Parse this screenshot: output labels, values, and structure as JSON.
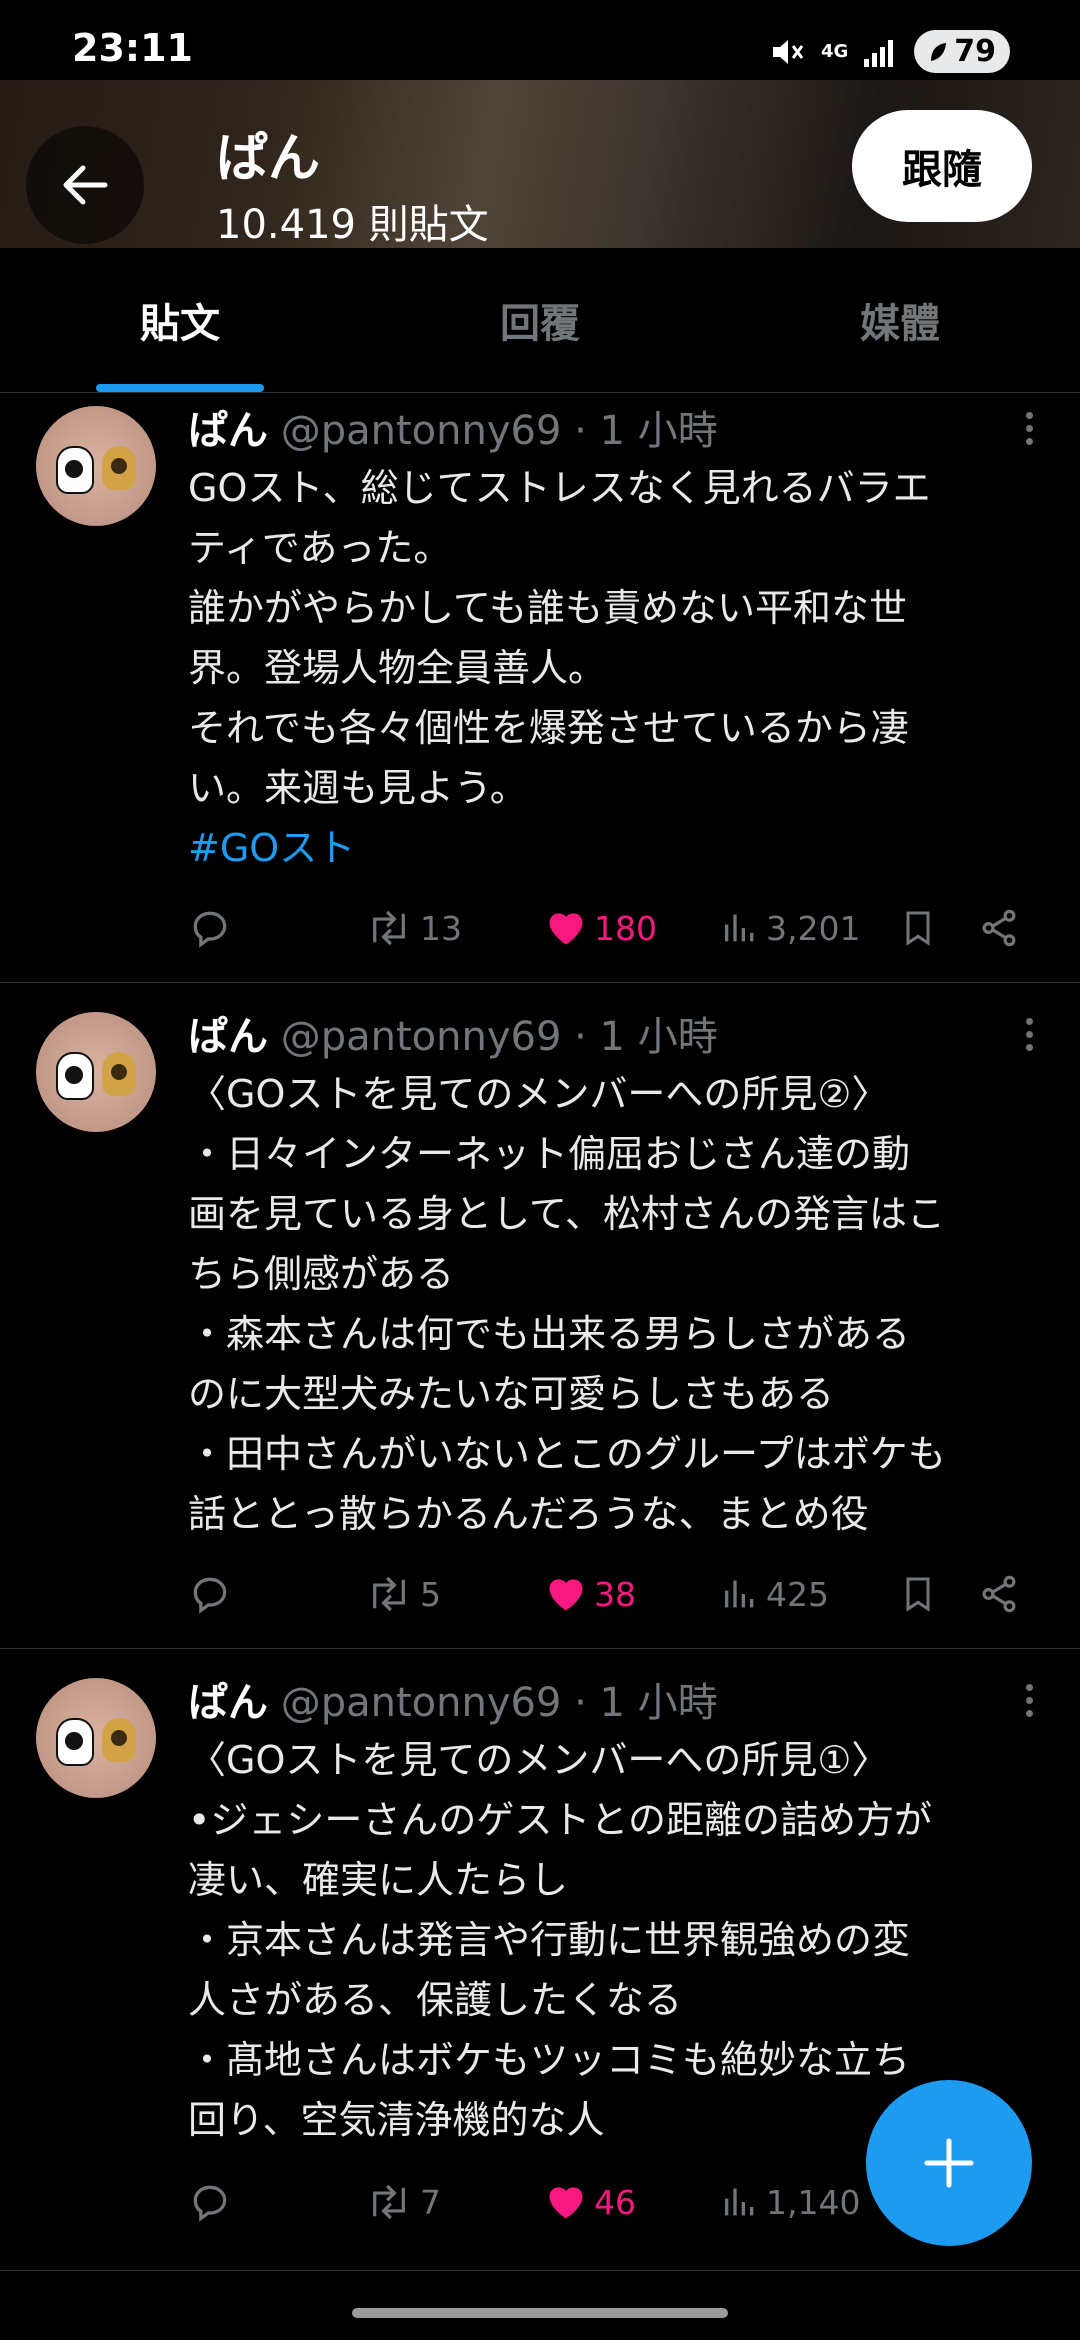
{
  "status_bar": {
    "time": "23:11",
    "network": "4G",
    "battery": "79"
  },
  "header": {
    "title": "ぱん",
    "post_count": "10.419 則貼文",
    "follow_label": "跟隨"
  },
  "tabs": [
    {
      "label": "貼文",
      "active": true
    },
    {
      "label": "回覆",
      "active": false
    },
    {
      "label": "媒體",
      "active": false
    }
  ],
  "tweets": [
    {
      "name": "ぱん",
      "handle": "@pantonny69",
      "time": "· 1 小時",
      "lines": [
        "GOスト、総じてストレスなく見れるバラエ",
        "ティであった。",
        "誰かがやらかしても誰も責めない平和な世",
        "界。登場人物全員善人。",
        "それでも各々個性を爆発させているから凄",
        "い。来週も見よう。"
      ],
      "hashtag": "#GOスト",
      "retweets": "13",
      "likes": "180",
      "views": "3,201"
    },
    {
      "name": "ぱん",
      "handle": "@pantonny69",
      "time": "· 1 小時",
      "lines": [
        "〈GOストを見てのメンバーへの所見②〉",
        "・日々インターネット偏屈おじさん達の動",
        "画を見ている身として、松村さんの発言はこ",
        "ちら側感がある",
        "・森本さんは何でも出来る男らしさがある",
        "のに大型犬みたいな可愛らしさもある",
        "・田中さんがいないとこのグループはボケも",
        "話ととっ散らかるんだろうな、まとめ役"
      ],
      "retweets": "5",
      "likes": "38",
      "views": "425"
    },
    {
      "name": "ぱん",
      "handle": "@pantonny69",
      "time": "· 1 小時",
      "lines": [
        "〈GOストを見てのメンバーへの所見①〉",
        "•ジェシーさんのゲストとの距離の詰め方が",
        "凄い、確実に人たらし",
        "・京本さんは発言や行動に世界観強めの変",
        "人さがある、保護したくなる",
        "・髙地さんはボケもツッコミも絶妙な立ち",
        "回り、空気清浄機的な人"
      ],
      "retweets": "7",
      "likes": "46",
      "views": "1,140"
    }
  ],
  "colors": {
    "accent": "#1d9bf0",
    "like": "#f91880",
    "muted": "#71767b",
    "background": "#000000"
  }
}
